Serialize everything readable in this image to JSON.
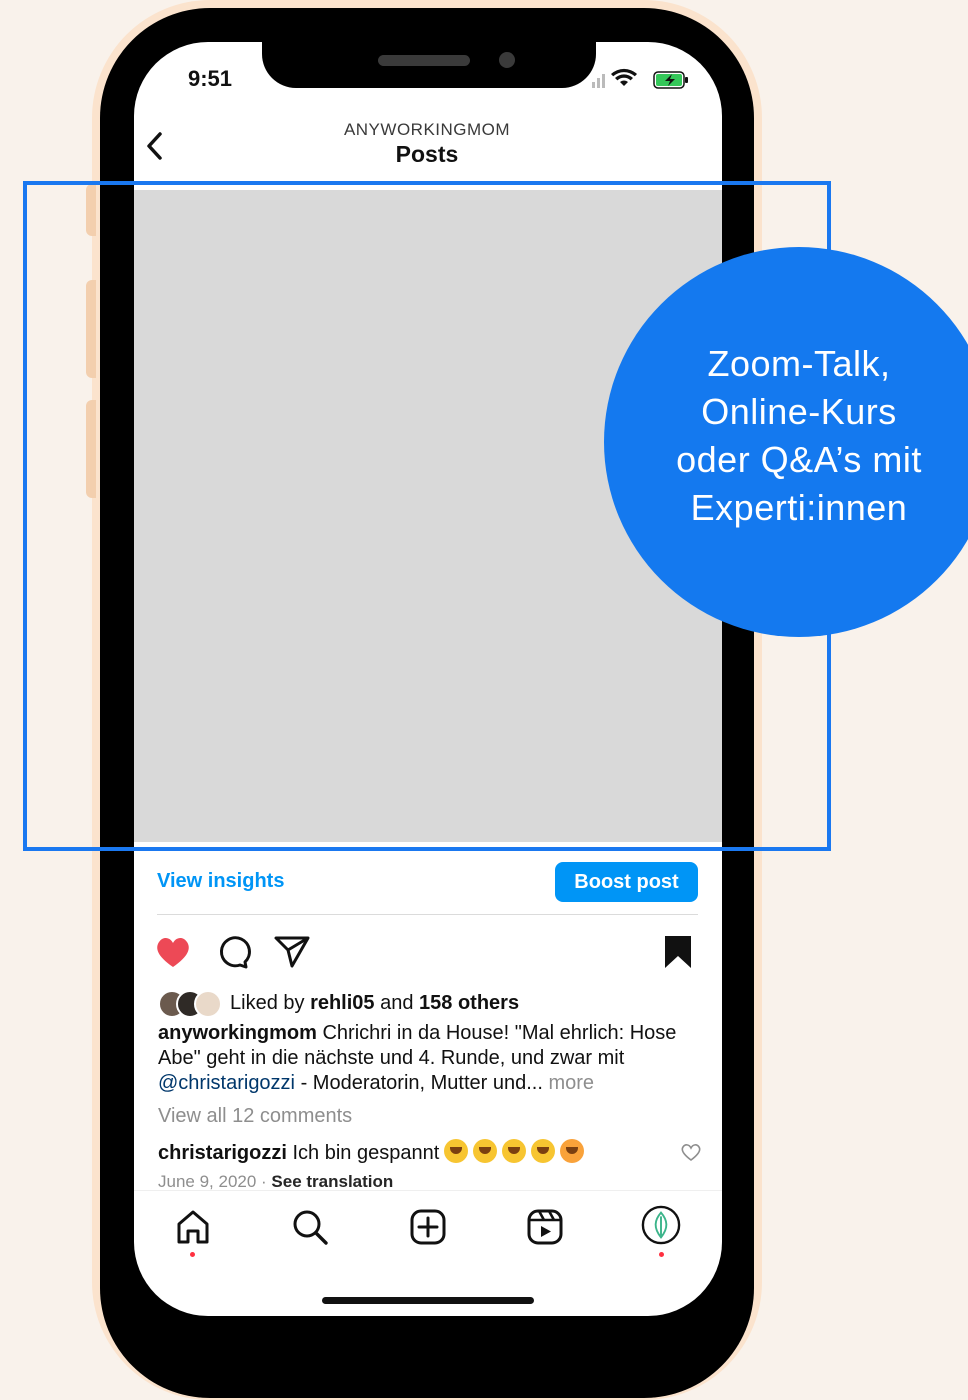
{
  "status_bar": {
    "time": "9:51"
  },
  "header": {
    "account": "ANYWORKINGMOM",
    "title": "Posts"
  },
  "callout": {
    "lines": [
      "Zoom-Talk,",
      "Online-Kurs",
      "oder Q&A’s mit",
      "Experti:innen"
    ]
  },
  "post": {
    "view_insights": "View insights",
    "boost_post": "Boost post",
    "likes": {
      "prefix": "Liked by ",
      "user": "rehli05",
      "middle": " and ",
      "others": "158 others"
    },
    "caption": {
      "username": "anyworkingmom",
      "text_part1": " Chrichri in da House! \"Mal ehrlich: Hose Abe\" geht in die nächste und 4. Runde, und zwar mit ",
      "mention": "@christarigozzi",
      "text_part2": " - Moderatorin, Mutter und...",
      "more": " more"
    },
    "view_comments": "View all 12 comments",
    "comment": {
      "username": "christarigozzi",
      "text": " Ich bin gespannt"
    },
    "date": "June 9, 2020",
    "separator": " · ",
    "see_translation": "See translation"
  },
  "colors": {
    "accent_blue": "#0095f6",
    "callout_blue": "#1479ef",
    "highlight_frame": "#1a78f0",
    "like_red": "#ed4956",
    "page_background": "#f9f2eb"
  },
  "icons": {
    "actions": [
      "heart-filled-icon",
      "comment-icon",
      "share-icon",
      "bookmark-filled-icon"
    ],
    "tabs": [
      "home-icon",
      "search-icon",
      "create-icon",
      "reels-icon",
      "profile-avatar"
    ]
  }
}
